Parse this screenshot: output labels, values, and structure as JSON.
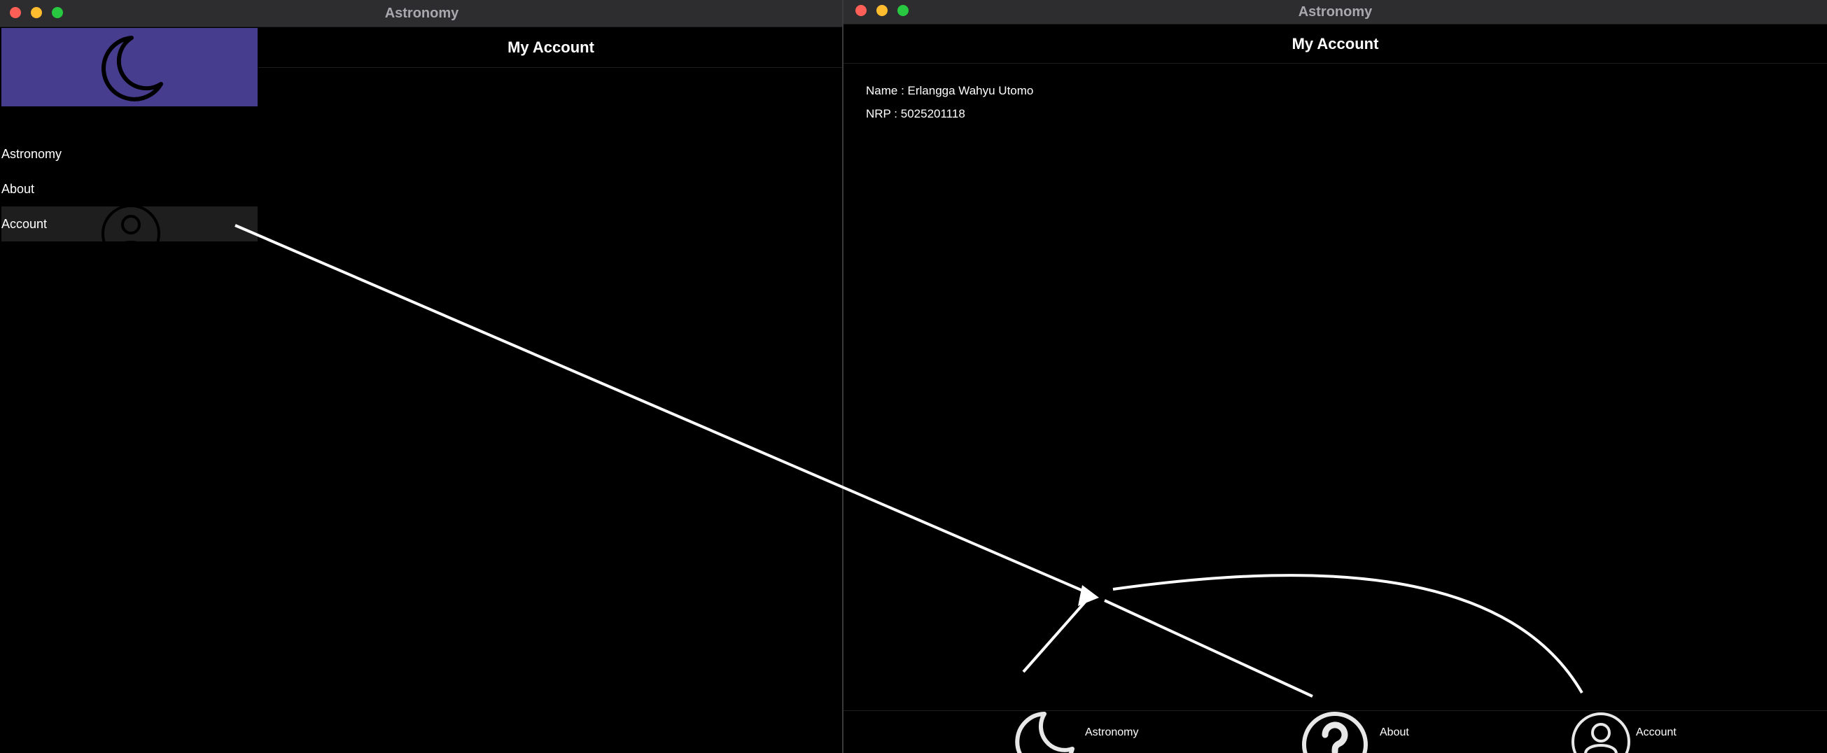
{
  "left_window": {
    "title": "Astronomy",
    "header_title": "My Account",
    "drawer": {
      "header_icon": "moon-icon",
      "items": [
        {
          "label": "Astronomy"
        },
        {
          "label": "About"
        },
        {
          "label": "Account",
          "selected": true,
          "icon": "person-icon"
        }
      ]
    }
  },
  "right_window": {
    "title": "Astronomy",
    "header_title": "My Account",
    "account": {
      "name_line": "Name : Erlangga Wahyu Utomo",
      "nrp_line": "NRP : 5025201118"
    },
    "bottom_nav": [
      {
        "label": "Astronomy",
        "icon": "moon-icon"
      },
      {
        "label": "About",
        "icon": "question-icon"
      },
      {
        "label": "Account",
        "icon": "person-icon"
      }
    ]
  },
  "colors": {
    "drawer_header": "#463d8e",
    "selected_item": "#1e1e1e",
    "background": "#000000"
  }
}
